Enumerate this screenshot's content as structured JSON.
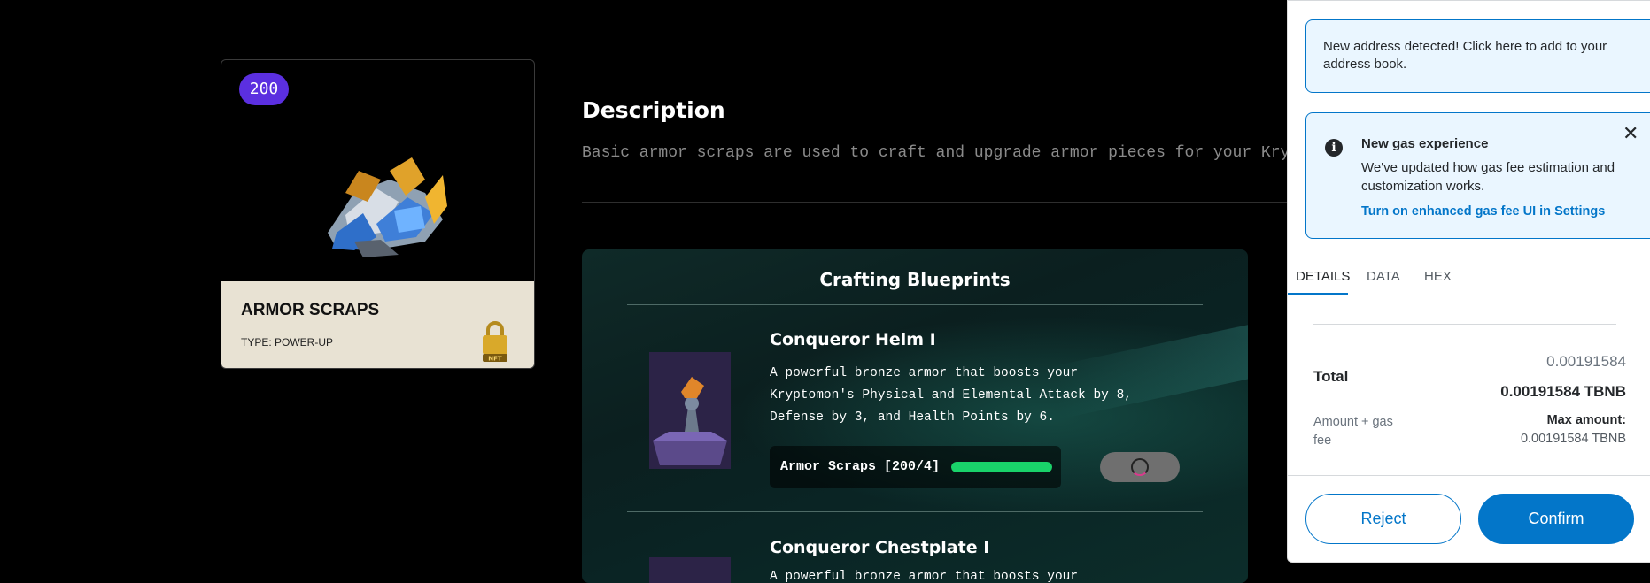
{
  "item_card": {
    "quantity_badge": "200",
    "name": "ARMOR SCRAPS",
    "type": "TYPE: POWER-UP",
    "lock_label": "NFT"
  },
  "description": {
    "title": "Description",
    "text": "Basic armor scraps are used to craft and upgrade armor pieces for your Krypt"
  },
  "blueprints": {
    "heading": "Crafting Blueprints",
    "items": [
      {
        "title": "Conqueror Helm I",
        "text": "A powerful bronze armor that boosts your Kryptomon's Physical and Elemental Attack by 8, Defense by 3, and Health Points by 6.",
        "requirement_label": "Armor Scraps [200/4]",
        "requirement_progress": 1.0
      },
      {
        "title": "Conqueror Chestplate I",
        "text": "A powerful bronze armor that boosts your"
      }
    ]
  },
  "wallet": {
    "address_alert": "New address detected! Click here to add to your address book.",
    "gas_alert": {
      "title": "New gas experience",
      "body": "We've updated how gas fee estimation and customization works.",
      "link": "Turn on enhanced gas fee UI in Settings",
      "close": "✕"
    },
    "tabs": [
      "DETAILS",
      "DATA",
      "HEX"
    ],
    "active_tab": "DETAILS",
    "total": {
      "label": "Total",
      "secondary": "0.00191584",
      "primary": "0.00191584 TBNB"
    },
    "amount_gas": {
      "label": "Amount + gas fee",
      "max_label": "Max amount:",
      "max_value": "0.00191584 TBNB"
    },
    "buttons": {
      "reject": "Reject",
      "confirm": "Confirm"
    },
    "colors": {
      "accent": "#0376c9",
      "progress": "#19d36a",
      "badge": "#5b2fe0"
    }
  }
}
